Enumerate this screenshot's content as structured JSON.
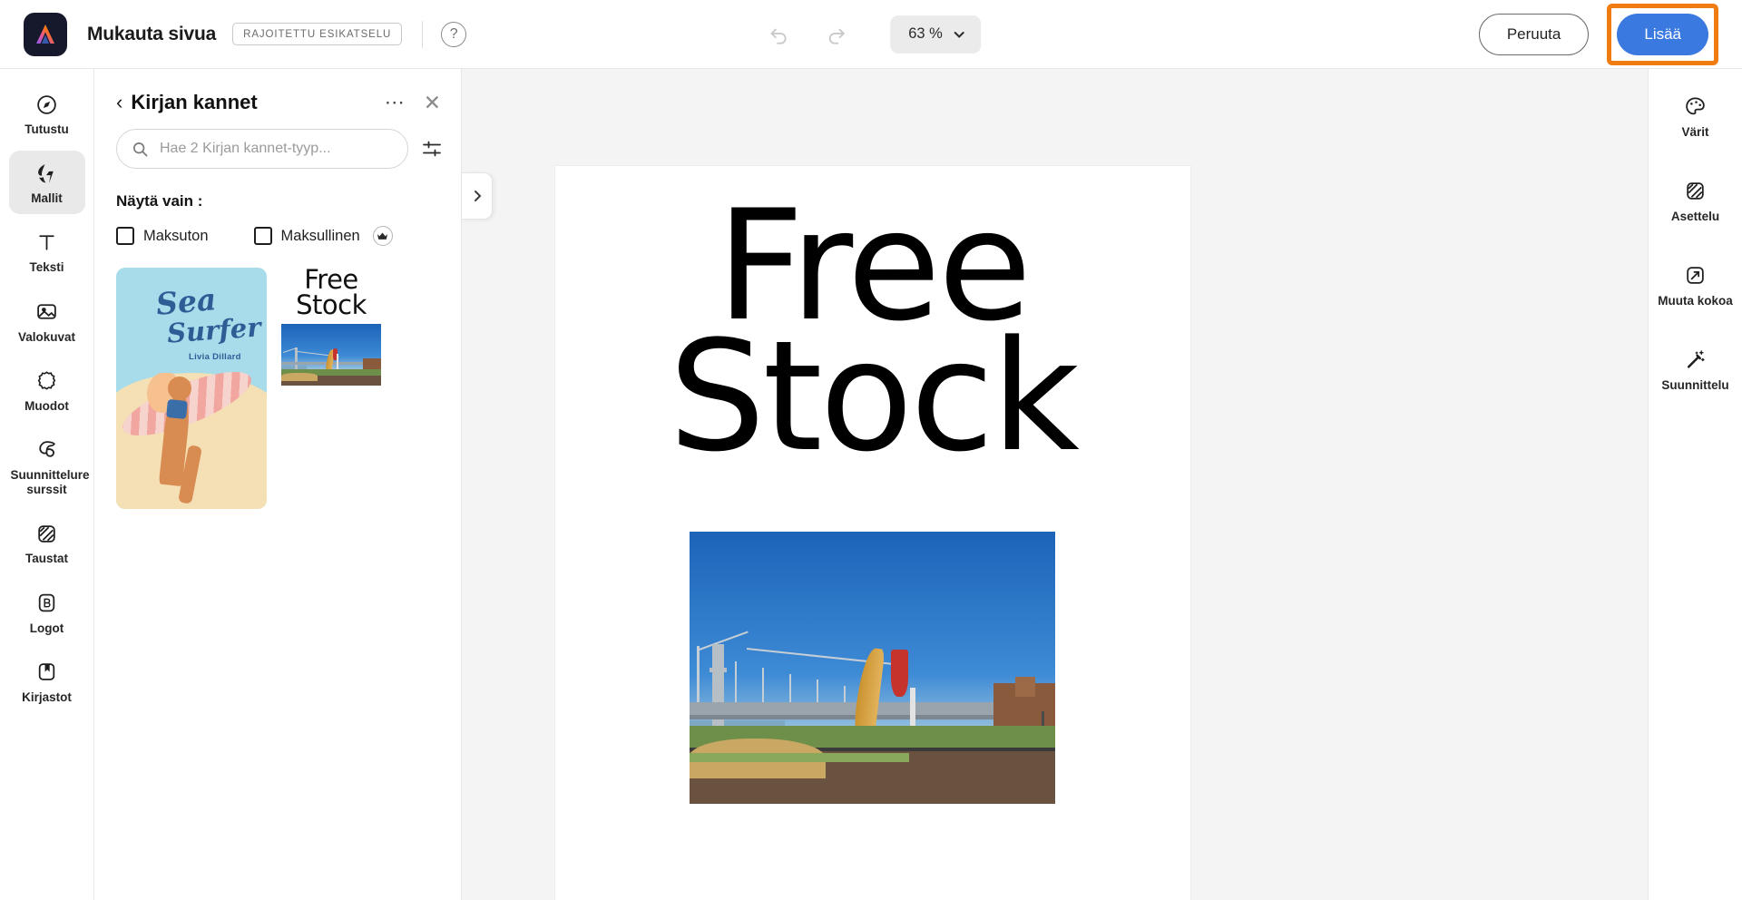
{
  "app": {
    "logo_icon": "adobe-express-logo",
    "title": "Mukauta sivua",
    "preview_badge": "RAJOITETTU ESIKATSELU",
    "help_icon": "?"
  },
  "toolbar": {
    "undo_icon": "undo-arrow-icon",
    "redo_icon": "redo-arrow-icon",
    "zoom_value": "63 %",
    "zoom_caret_icon": "chevron-down-icon",
    "cancel_label": "Peruuta",
    "add_label": "Lisää",
    "highlight_color": "#f07b10",
    "primary_color": "#3a7ae0"
  },
  "left_rail": {
    "items": [
      {
        "label": "Tutustu",
        "icon": "compass-icon",
        "active": false
      },
      {
        "label": "Mallit",
        "icon": "templates-icon",
        "active": true
      },
      {
        "label": "Teksti",
        "icon": "text-t-icon",
        "active": false
      },
      {
        "label": "Valokuvat",
        "icon": "photo-icon",
        "active": false
      },
      {
        "label": "Muodot",
        "icon": "shapes-icon",
        "active": false
      },
      {
        "label": "Suunnittelure surssit",
        "icon": "design-assets-icon",
        "active": false
      },
      {
        "label": "Taustat",
        "icon": "backgrounds-icon",
        "active": false
      },
      {
        "label": "Logot",
        "icon": "brand-logo-icon",
        "active": false
      },
      {
        "label": "Kirjastot",
        "icon": "libraries-icon",
        "active": false
      }
    ]
  },
  "panel": {
    "back_icon": "chevron-left-icon",
    "title": "Kirjan kannet",
    "more_icon": "more-dots-icon",
    "close_icon": "close-x-icon",
    "search": {
      "icon": "search-icon",
      "placeholder": "Hae 2 Kirjan kannet-tyyp...",
      "value": "",
      "filter_icon": "filter-sliders-icon"
    },
    "filters": {
      "label": "Näytä vain :",
      "options": [
        {
          "label": "Maksuton",
          "checked": false,
          "premium": false
        },
        {
          "label": "Maksullinen",
          "checked": false,
          "premium": true,
          "badge_icon": "crown-icon"
        }
      ]
    },
    "templates": [
      {
        "name": "sea-surfer-cover",
        "title_line1": "Sea",
        "title_line2": "Surfer",
        "author": "Livia Dillard",
        "bg_color": "#a8dcea",
        "text_color": "#2e5d96"
      },
      {
        "name": "free-stock-cover",
        "title_line1": "Free",
        "title_line2": "Stock",
        "photo_alt": "cupids-span-bay-bridge-photo"
      }
    ],
    "collapse_icon": "chevron-right-icon"
  },
  "canvas": {
    "background_color": "#f4f4f4",
    "page": {
      "title_line1": "Free",
      "title_line2": "Stock",
      "photo_alt": "cupids-span-bay-bridge-photo"
    }
  },
  "right_rail": {
    "items": [
      {
        "label": "Värit",
        "icon": "color-palette-icon"
      },
      {
        "label": "Asettelu",
        "icon": "layout-icon"
      },
      {
        "label": "Muuta kokoa",
        "icon": "resize-icon"
      },
      {
        "label": "Suunnittelu",
        "icon": "magic-wand-icon"
      }
    ]
  }
}
